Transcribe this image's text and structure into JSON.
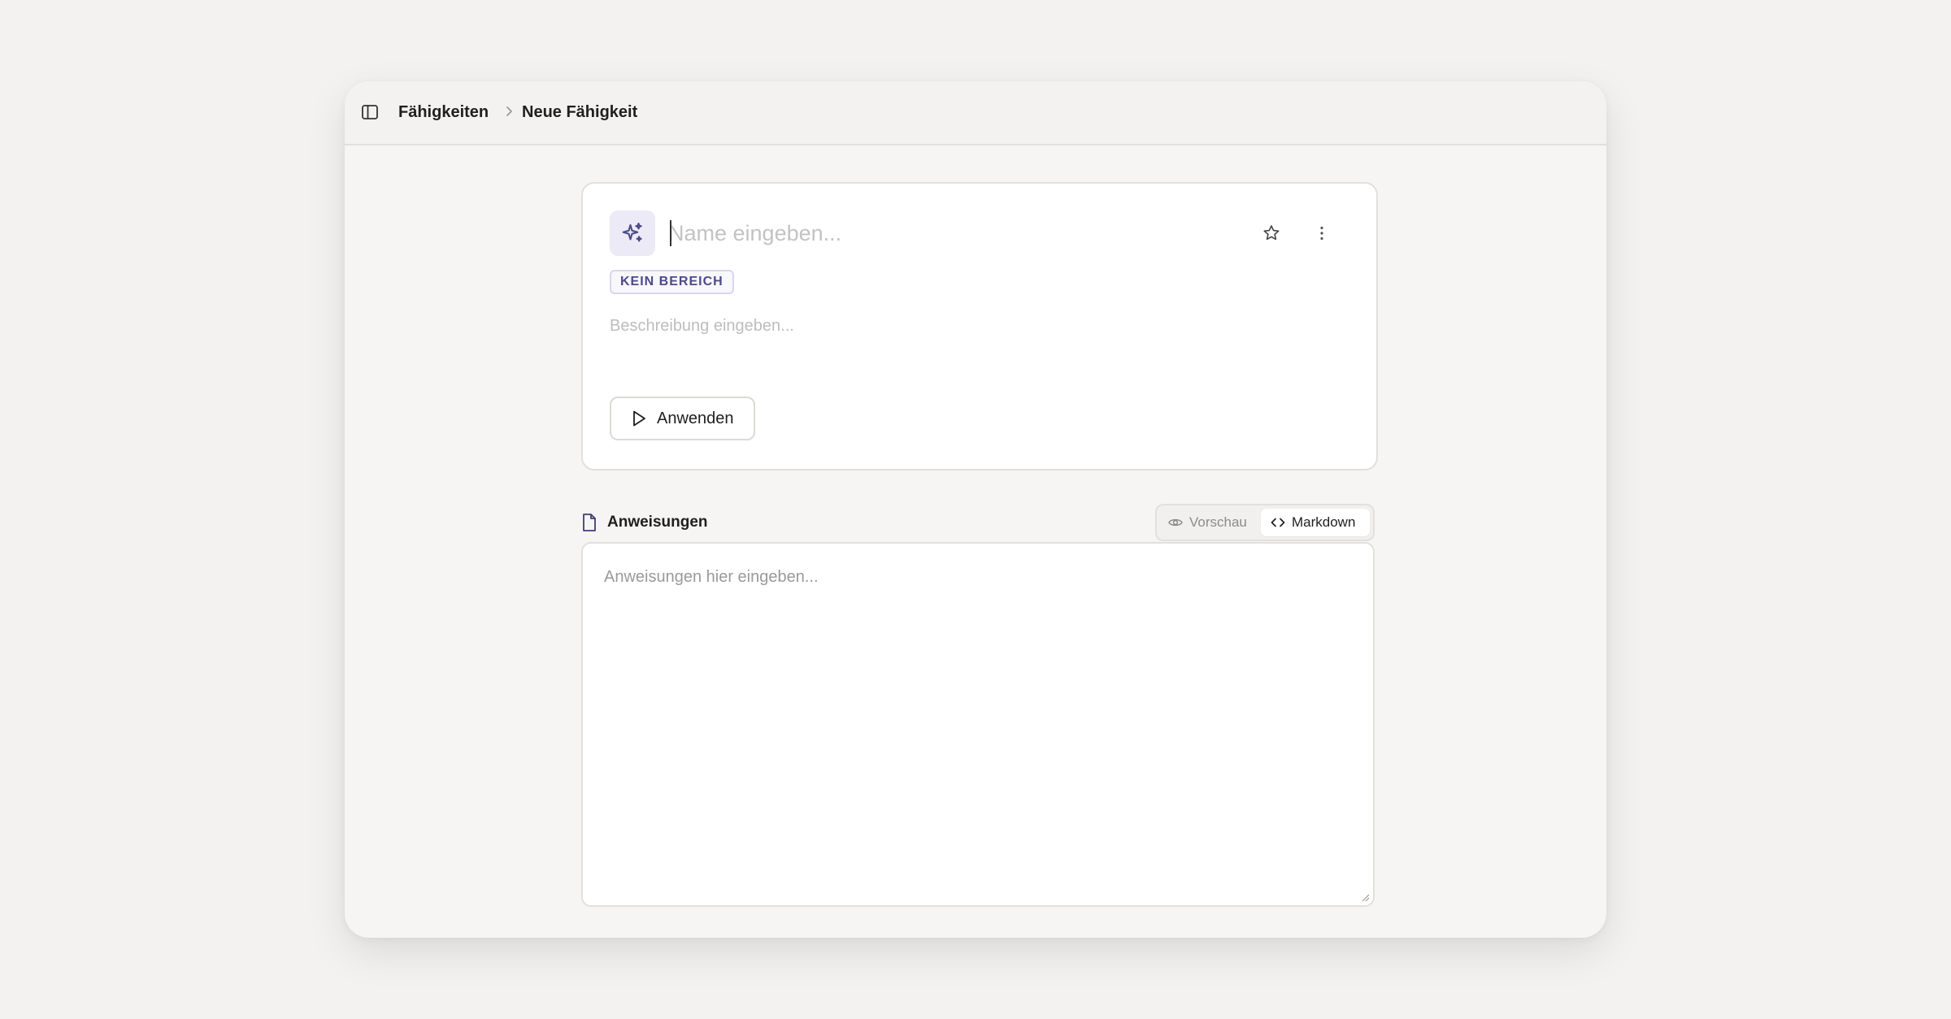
{
  "breadcrumb": {
    "root": "Fähigkeiten",
    "current": "Neue Fähigkeit"
  },
  "skill": {
    "name_placeholder": "Name eingeben...",
    "area_badge": "KEIN BEREICH",
    "description_placeholder": "Beschreibung eingeben...",
    "apply_label": "Anwenden"
  },
  "instructions": {
    "title": "Anweisungen",
    "preview_label": "Vorschau",
    "markdown_label": "Markdown",
    "placeholder": "Anweisungen hier eingeben...",
    "active_view": "Markdown"
  },
  "colors": {
    "accent": "#4d4a8a",
    "icon_bg": "#ebeaf6"
  },
  "icons": {
    "sidebar": "sidebar-icon",
    "separator": "chevron-right-icon",
    "skill": "sparkles-icon",
    "favorite": "star-icon",
    "more": "more-vertical-icon",
    "apply": "play-icon",
    "document": "file-icon",
    "preview": "eye-icon",
    "markdown": "code-icon"
  }
}
